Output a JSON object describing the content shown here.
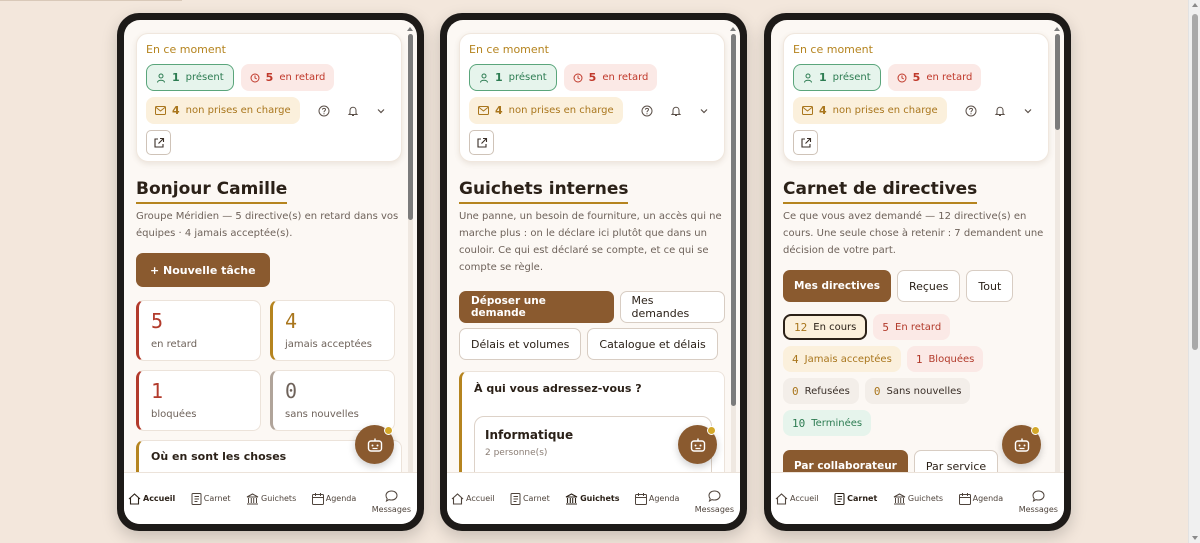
{
  "now_card": {
    "title": "En ce moment",
    "present": {
      "count": "1",
      "label": "présent"
    },
    "late": {
      "count": "5",
      "label": "en retard"
    },
    "unassigned": {
      "count": "4",
      "label": "non prises en charge"
    }
  },
  "nav": {
    "accueil": "Accueil",
    "carnet": "Carnet",
    "guichets": "Guichets",
    "agenda": "Agenda",
    "messages": "Messages"
  },
  "screen1": {
    "title": "Bonjour Camille",
    "description": "Groupe Méridien — 5 directive(s) en retard dans vos équipes · 4 jamais acceptée(s).",
    "new_task_button": "+ Nouvelle tâche",
    "stats": [
      {
        "value": "5",
        "label": "en retard"
      },
      {
        "value": "4",
        "label": "jamais acceptées"
      },
      {
        "value": "1",
        "label": "bloquées"
      },
      {
        "value": "0",
        "label": "sans nouvelles"
      }
    ],
    "section_title": "Où en sont les choses"
  },
  "screen2": {
    "title": "Guichets internes",
    "description": "Une panne, un besoin de fourniture, un accès qui ne marche plus : on le déclare ici plutôt que dans un couloir. Ce qui est déclaré se compte, et ce qui se compte se règle.",
    "buttons": {
      "submit": "Déposer une demande",
      "mine": "Mes demandes",
      "delays": "Délais et volumes",
      "catalog": "Catalogue et délais"
    },
    "topic_title": "À qui vous adressez-vous ?",
    "topic": {
      "name": "Informatique",
      "sub": "2 personne(s)"
    }
  },
  "screen3": {
    "title": "Carnet de directives",
    "description": "Ce que vous avez demandé — 12 directive(s) en cours. Une seule chose à retenir : 7 demandent une décision de votre part.",
    "tabs": {
      "mine": "Mes directives",
      "received": "Reçues",
      "all": "Tout"
    },
    "filters": {
      "in_progress": {
        "count": "12",
        "label": "En cours"
      },
      "late": {
        "count": "5",
        "label": "En retard"
      },
      "never_accepted": {
        "count": "4",
        "label": "Jamais acceptées"
      },
      "blocked": {
        "count": "1",
        "label": "Bloquées"
      },
      "refused": {
        "count": "0",
        "label": "Refusées"
      },
      "no_news": {
        "count": "0",
        "label": "Sans nouvelles"
      },
      "done": {
        "count": "10",
        "label": "Terminées"
      }
    },
    "group": {
      "by_collaborator": "Par collaborateur",
      "by_service": "Par service"
    }
  }
}
